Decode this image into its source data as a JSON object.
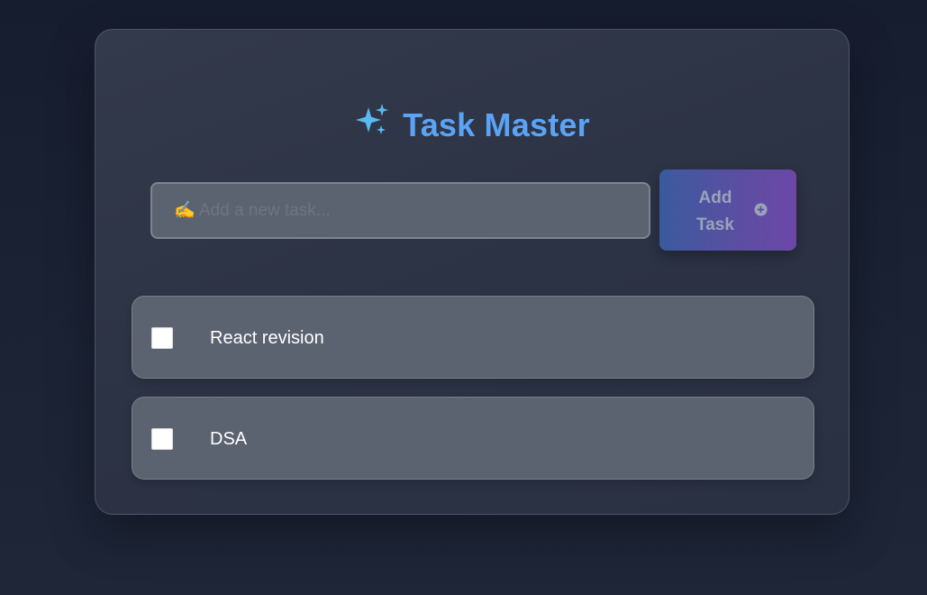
{
  "app": {
    "title": "Task Master",
    "title_icon": "sparkles-icon",
    "accent_color": "#5aa3f5"
  },
  "input": {
    "placeholder": "✍️ Add a new task...",
    "value": ""
  },
  "add_button": {
    "label": "Add Task",
    "icon": "plus-circle-icon"
  },
  "tasks": [
    {
      "text": "React revision",
      "completed": false
    },
    {
      "text": "DSA",
      "completed": false
    }
  ]
}
